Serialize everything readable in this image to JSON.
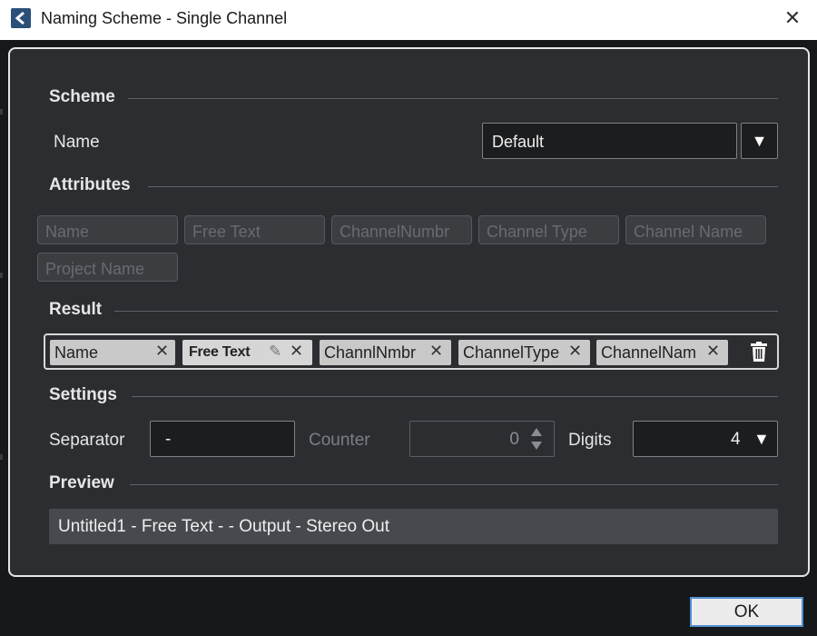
{
  "window": {
    "title": "Naming Scheme - Single Channel",
    "close_glyph": "✕"
  },
  "scheme": {
    "section_label": "Scheme",
    "name_label": "Name",
    "name_value": "Default",
    "dropdown_glyph": "▼"
  },
  "attributes": {
    "section_label": "Attributes",
    "items": [
      "Name",
      "Free Text",
      "ChannelNumbr",
      "Channel Type",
      "Channel Name",
      "Project Name"
    ]
  },
  "result": {
    "section_label": "Result",
    "chips": [
      {
        "label": "Name",
        "close": "✕"
      },
      {
        "label": "Free Text",
        "close": "✕",
        "edit": "✎"
      },
      {
        "label": "ChannlNmbr",
        "close": "✕"
      },
      {
        "label": "ChannelType",
        "close": "✕"
      },
      {
        "label": "ChannelNam",
        "close": "✕"
      }
    ]
  },
  "settings": {
    "section_label": "Settings",
    "separator_label": "Separator",
    "separator_value": "-",
    "counter_label": "Counter",
    "counter_value": "0",
    "digits_label": "Digits",
    "digits_value": "4",
    "dropdown_glyph": "▼"
  },
  "preview": {
    "section_label": "Preview",
    "text": "Untitled1 - Free Text -  - Output - Stereo Out"
  },
  "footer": {
    "ok_label": "OK"
  },
  "colors": {
    "accent": "#4f91d3",
    "panel": "#2b2d30",
    "icon_bg": "#2a4f79"
  }
}
